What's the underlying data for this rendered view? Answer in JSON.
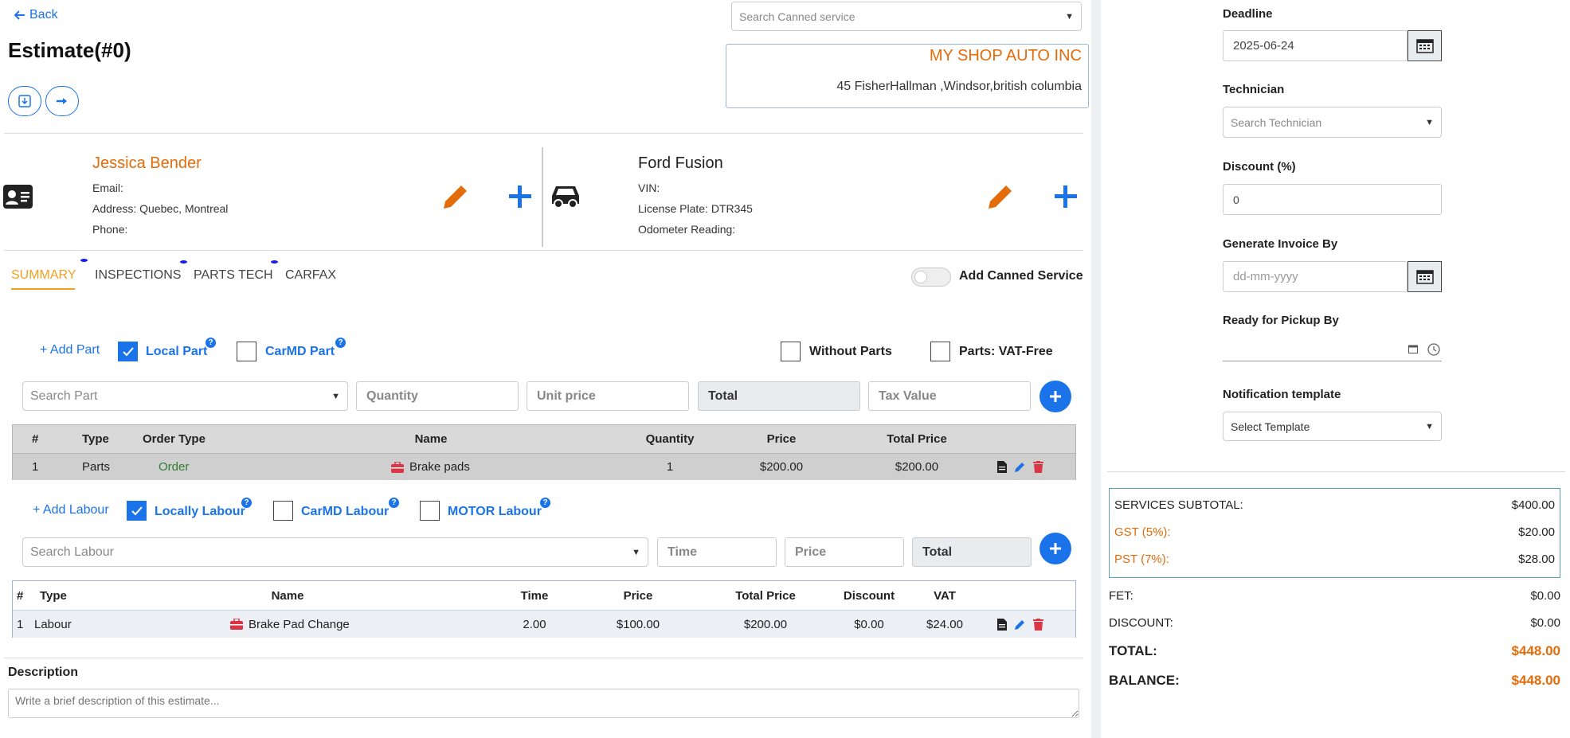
{
  "header": {
    "back_label": "Back",
    "title": "Estimate(#0)",
    "canned_service_placeholder": "Search Canned service"
  },
  "shop": {
    "name": "MY SHOP AUTO INC",
    "address": "45 FisherHallman ,Windsor,british columbia"
  },
  "customer": {
    "name": "Jessica Bender",
    "email_label": "Email:",
    "address_label": "Address: Quebec, Montreal",
    "phone_label": "Phone:"
  },
  "vehicle": {
    "name": "Ford Fusion",
    "vin_label": "VIN:",
    "plate_label": "License Plate: DTR345",
    "odometer_label": "Odometer Reading:"
  },
  "tabs": [
    {
      "label": "SUMMARY",
      "active": true
    },
    {
      "label": "INSPECTIONS",
      "active": false
    },
    {
      "label": "PARTS TECH",
      "active": false
    },
    {
      "label": "CARFAX",
      "active": false
    }
  ],
  "add_canned_service_label": "Add Canned Service",
  "parts": {
    "add_label": "+ Add Part",
    "local_label": "Local Part",
    "carmd_label": "CarMD Part",
    "without_parts_label": "Without Parts",
    "vat_free_label": "Parts: VAT-Free",
    "search_placeholder": "Search Part",
    "quantity_placeholder": "Quantity",
    "unit_price_placeholder": "Unit price",
    "total_label": "Total",
    "tax_placeholder": "Tax Value",
    "headers": [
      "#",
      "Type",
      "Order Type",
      "Name",
      "Quantity",
      "Price",
      "Total Price"
    ],
    "rows": [
      {
        "num": "1",
        "type": "Parts",
        "order_type": "Order",
        "name": "Brake pads",
        "quantity": "1",
        "price": "$200.00",
        "total": "$200.00"
      }
    ]
  },
  "labour": {
    "add_label": "+ Add Labour",
    "local_label": "Locally Labour",
    "carmd_label": "CarMD Labour",
    "motor_label": "MOTOR Labour",
    "search_placeholder": "Search Labour",
    "time_placeholder": "Time",
    "price_placeholder": "Price",
    "total_label": "Total",
    "headers": [
      "#",
      "Type",
      "Name",
      "Time",
      "Price",
      "Total Price",
      "Discount",
      "VAT"
    ],
    "rows": [
      {
        "num": "1",
        "type": "Labour",
        "name": "Brake Pad Change",
        "time": "2.00",
        "price": "$100.00",
        "total": "$200.00",
        "discount": "$0.00",
        "vat": "$24.00"
      }
    ]
  },
  "description": {
    "label": "Description",
    "placeholder": "Write a brief description of this estimate..."
  },
  "right": {
    "deadline_label": "Deadline",
    "deadline_value": "2025-06-24",
    "technician_label": "Technician",
    "technician_placeholder": "Search Technician",
    "discount_label": "Discount (%)",
    "discount_value": "0",
    "generate_invoice_label": "Generate Invoice By",
    "generate_invoice_placeholder": "dd-mm-yyyy",
    "pickup_label": "Ready for Pickup By",
    "notification_label": "Notification template",
    "notification_placeholder": "Select Template"
  },
  "totals": {
    "services_subtotal_label": "SERVICES SUBTOTAL:",
    "services_subtotal_value": "$400.00",
    "gst_label": "GST (5%):",
    "gst_value": "$20.00",
    "pst_label": "PST (7%):",
    "pst_value": "$28.00",
    "fet_label": "FET:",
    "fet_value": "$0.00",
    "discount_label": "DISCOUNT:",
    "discount_value": "$0.00",
    "total_label": "TOTAL:",
    "total_value": "$448.00",
    "balance_label": "BALANCE:",
    "balance_value": "$448.00"
  },
  "colors": {
    "primary": "#1a73e8",
    "accent_orange": "#e36c0a",
    "tab_active": "#f0a020",
    "delete_red": "#dc3545",
    "order_green": "#2e7d32"
  }
}
